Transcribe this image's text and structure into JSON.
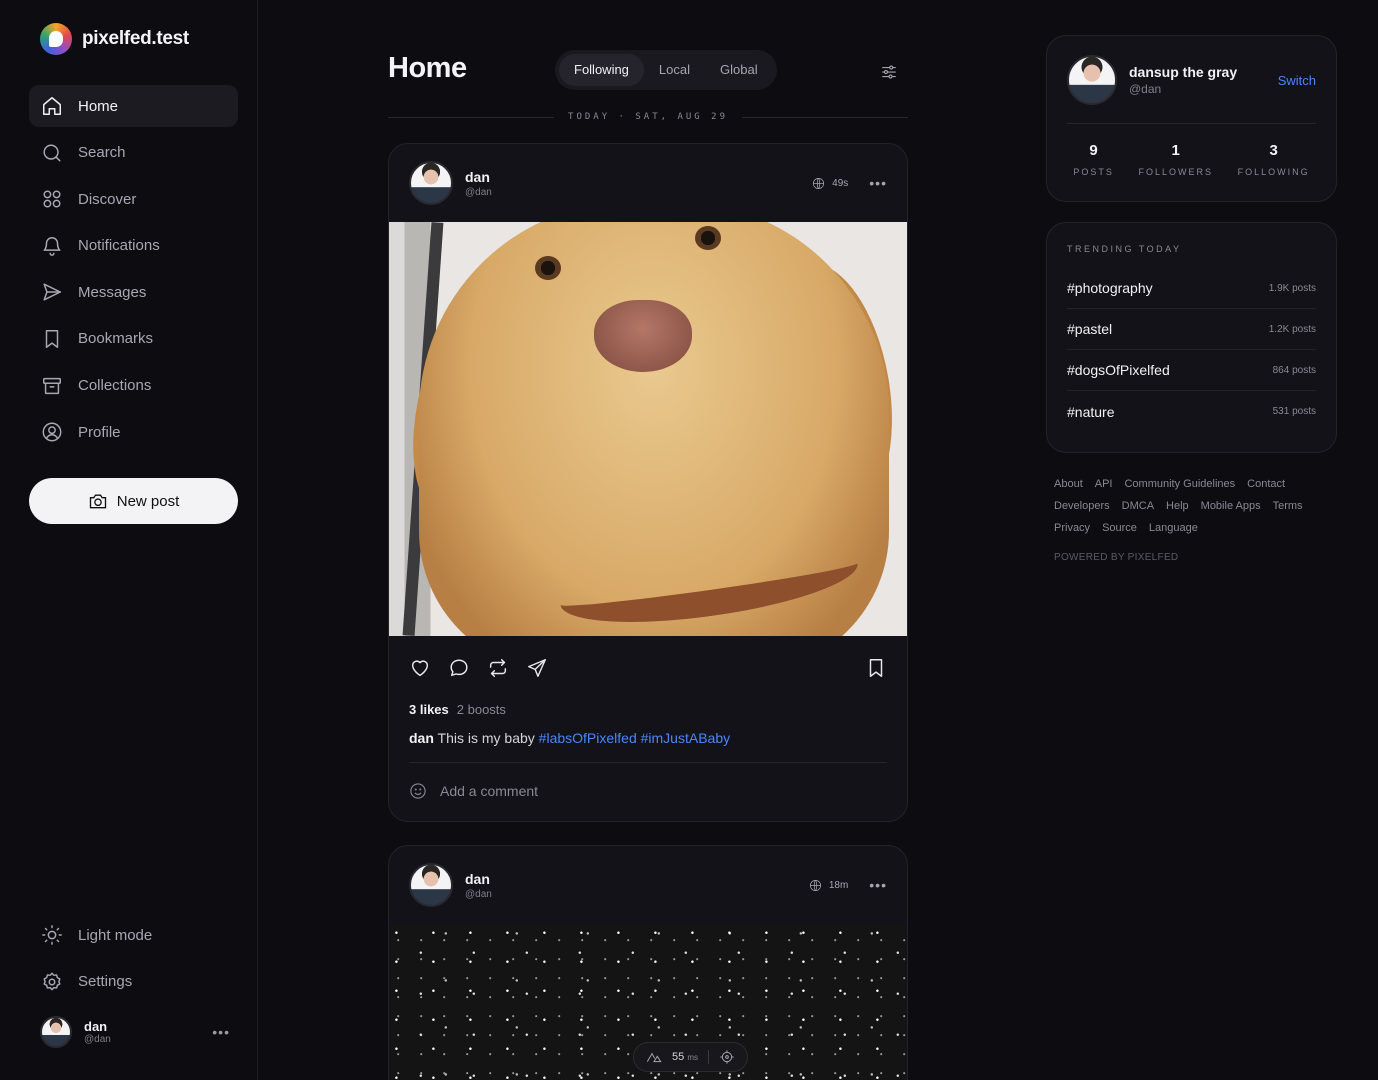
{
  "brand": {
    "name": "pixelfed.test"
  },
  "sidebar": {
    "items": [
      {
        "label": "Home",
        "icon": "home-icon",
        "active": true
      },
      {
        "label": "Search",
        "icon": "search-icon"
      },
      {
        "label": "Discover",
        "icon": "grid-icon"
      },
      {
        "label": "Notifications",
        "icon": "bell-icon"
      },
      {
        "label": "Messages",
        "icon": "send-icon"
      },
      {
        "label": "Bookmarks",
        "icon": "bookmark-icon"
      },
      {
        "label": "Collections",
        "icon": "archive-icon"
      },
      {
        "label": "Profile",
        "icon": "user-circle-icon"
      }
    ],
    "new_post": "New post",
    "light_mode": "Light mode",
    "settings": "Settings",
    "user": {
      "name": "dan",
      "handle": "@dan"
    }
  },
  "header": {
    "title": "Home",
    "tabs": [
      "Following",
      "Local",
      "Global"
    ],
    "active_tab": "Following"
  },
  "date_divider": "TODAY · SAT, AUG 29",
  "posts": [
    {
      "name": "dan",
      "handle": "@dan",
      "time": "49s",
      "likes": "3 likes",
      "boosts": "2 boosts",
      "caption_user": "dan",
      "caption_text": "This is my baby",
      "tags": [
        "#labsOfPixelfed",
        "#imJustABaby"
      ],
      "comment_placeholder": "Add a comment"
    },
    {
      "name": "dan",
      "handle": "@dan",
      "time": "18m"
    }
  ],
  "devtools": {
    "value": "55",
    "unit": "ms"
  },
  "profile_card": {
    "name": "dansup the gray",
    "handle": "@dan",
    "switch": "Switch",
    "stats": [
      {
        "value": "9",
        "label": "POSTS"
      },
      {
        "value": "1",
        "label": "FOLLOWERS"
      },
      {
        "value": "3",
        "label": "FOLLOWING"
      }
    ]
  },
  "trending": {
    "title": "TRENDING TODAY",
    "items": [
      {
        "tag": "#photography",
        "count": "1.9K posts"
      },
      {
        "tag": "#pastel",
        "count": "1.2K posts"
      },
      {
        "tag": "#dogsOfPixelfed",
        "count": "864 posts"
      },
      {
        "tag": "#nature",
        "count": "531 posts"
      }
    ]
  },
  "footer": {
    "links": [
      "About",
      "API",
      "Community Guidelines",
      "Contact",
      "Developers",
      "DMCA",
      "Help",
      "Mobile Apps",
      "Terms",
      "Privacy",
      "Source",
      "Language"
    ],
    "powered": "POWERED BY PIXELFED"
  },
  "colors": {
    "background": "#0d0c11",
    "card": "#131218",
    "accent": "#4a86ff"
  }
}
